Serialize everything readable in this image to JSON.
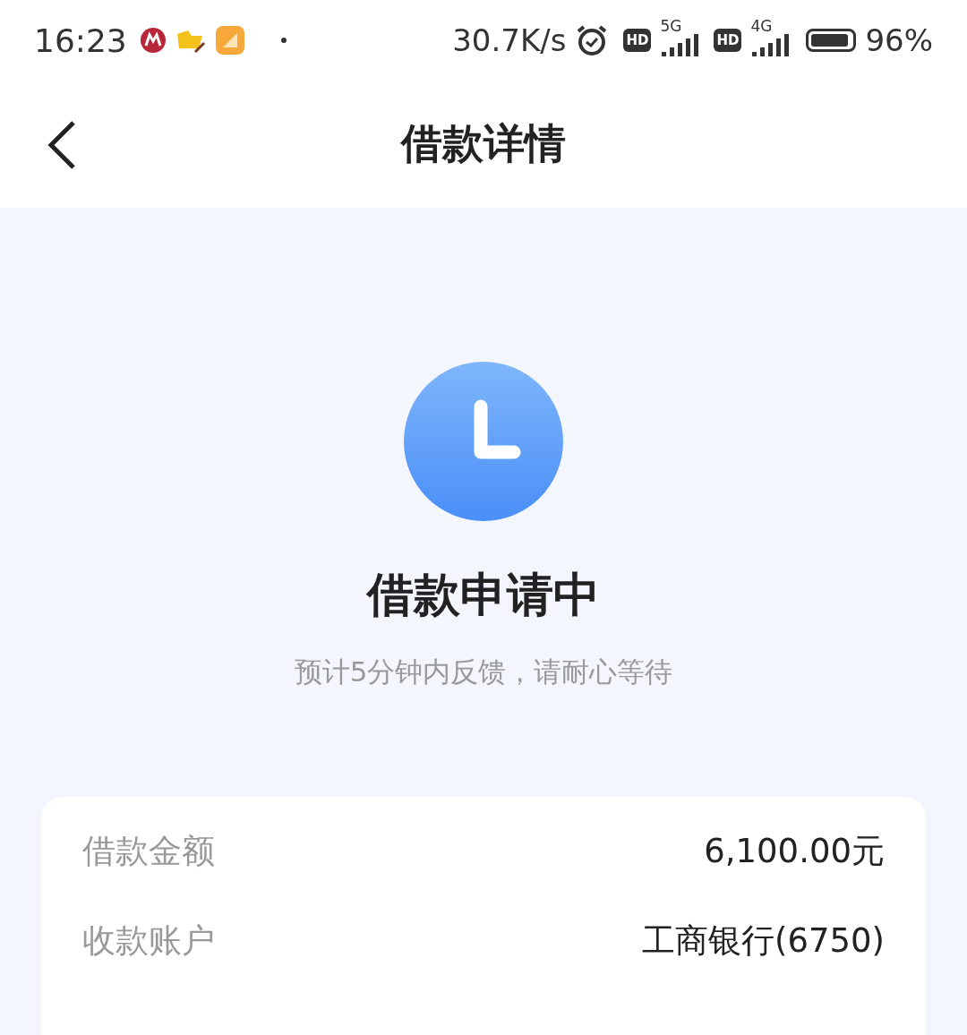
{
  "status_bar": {
    "time": "16:23",
    "net_speed": "30.7K/s",
    "sim1": {
      "hd": "HD",
      "network": "5G"
    },
    "sim2": {
      "hd": "HD",
      "network": "4G"
    },
    "battery": {
      "percent": "96%"
    }
  },
  "header": {
    "title": "借款详情"
  },
  "status": {
    "title": "借款申请中",
    "subtitle": "预计5分钟内反馈，请耐心等待"
  },
  "details": [
    {
      "label": "借款金额",
      "value": "6,100.00元"
    },
    {
      "label": "收款账户",
      "value": "工商银行(6750)"
    }
  ]
}
